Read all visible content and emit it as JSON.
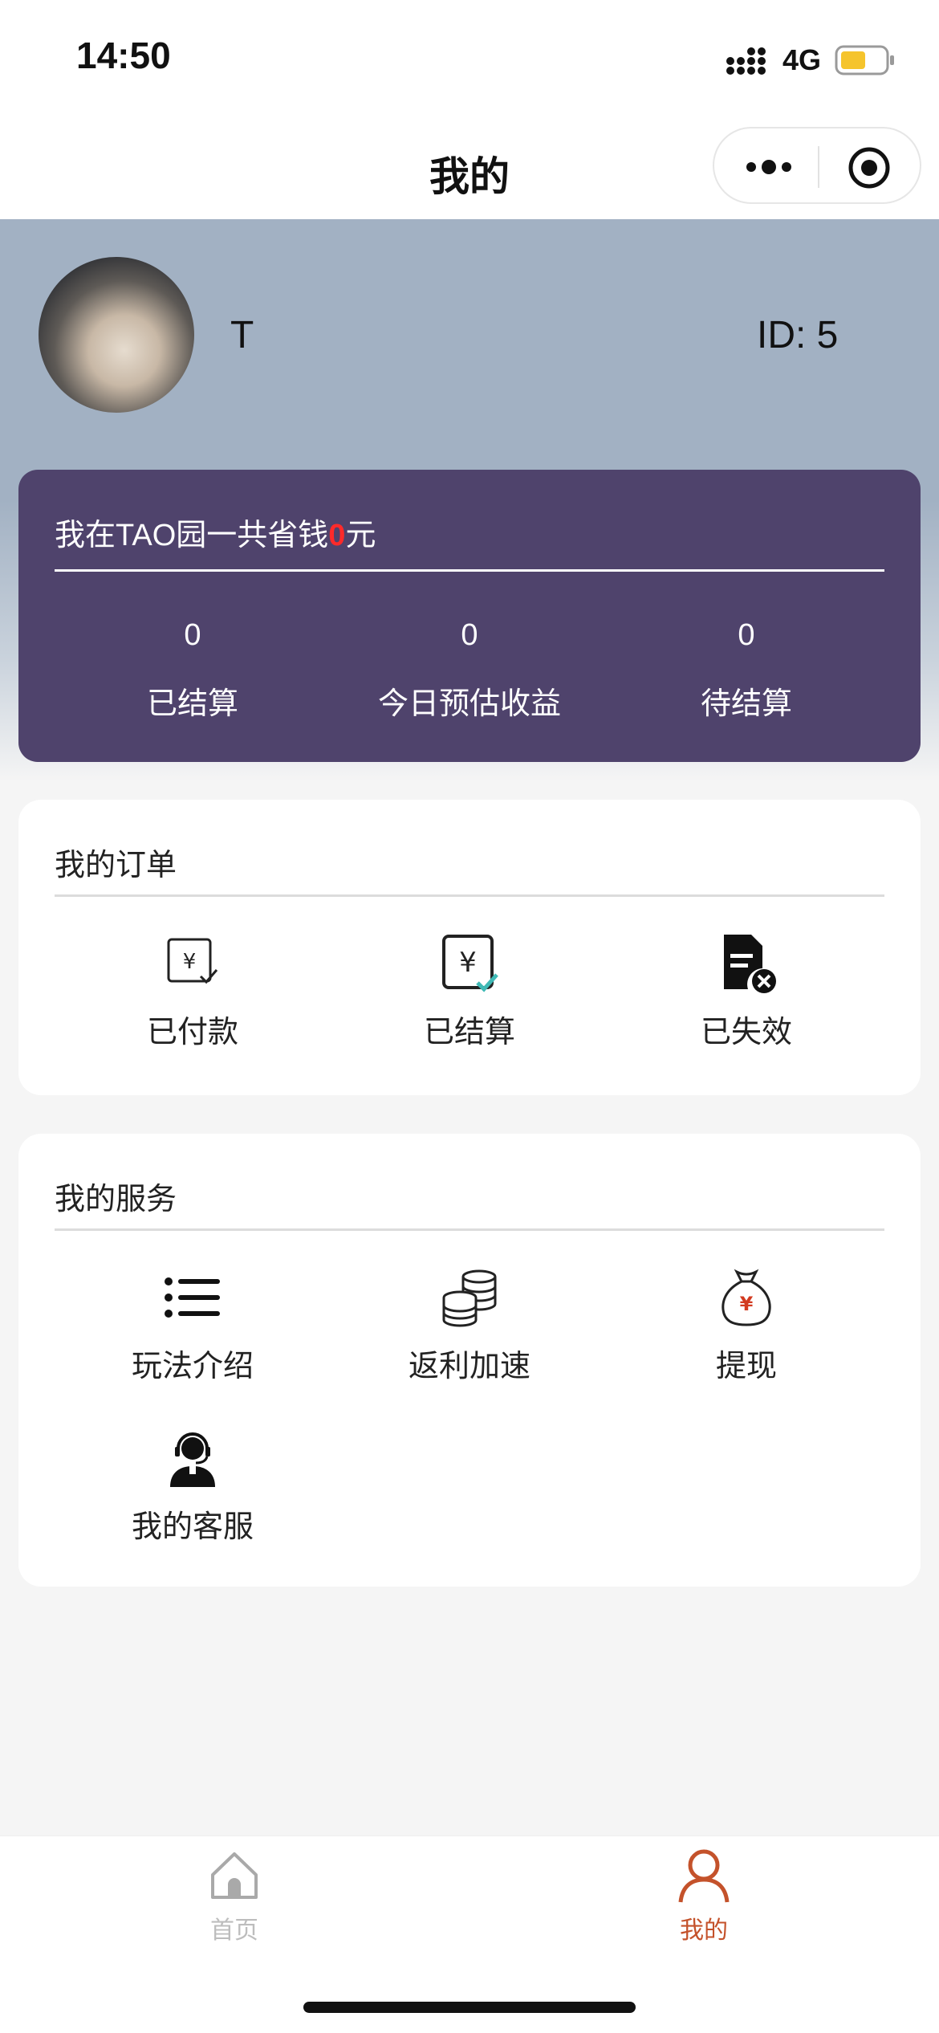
{
  "status_bar": {
    "time": "14:50",
    "network": "4G",
    "icons": [
      "signal-icon",
      "battery-icon"
    ],
    "battery_color": "#f5c42c"
  },
  "nav": {
    "title": "我的",
    "icons": [
      "more-icon",
      "close-mini-icon"
    ]
  },
  "profile": {
    "name": "T",
    "id_text": "ID: 5"
  },
  "earnings": {
    "savings_prefix": "我在TAO园一共省钱",
    "savings_amount": "0",
    "savings_suffix": "元",
    "stats": [
      {
        "value": "0",
        "label": "已结算"
      },
      {
        "value": "0",
        "label": "今日预估收益"
      },
      {
        "value": "0",
        "label": "待结算"
      }
    ],
    "card_color": "#4f436c",
    "amount_color": "#ff2a2a"
  },
  "orders": {
    "title": "我的订单",
    "items": [
      {
        "label": "已付款",
        "icon": "yuan-paid-icon"
      },
      {
        "label": "已结算",
        "icon": "yuan-settled-icon"
      },
      {
        "label": "已失效",
        "icon": "document-invalid-icon"
      }
    ]
  },
  "services": {
    "title": "我的服务",
    "items": [
      {
        "label": "玩法介绍",
        "icon": "list-icon"
      },
      {
        "label": "返利加速",
        "icon": "coins-stack-icon"
      },
      {
        "label": "提现",
        "icon": "money-bag-icon"
      },
      {
        "label": "我的客服",
        "icon": "customer-service-icon"
      }
    ]
  },
  "tab_bar": {
    "tabs": [
      {
        "label": "首页",
        "icon": "home-icon",
        "active": false
      },
      {
        "label": "我的",
        "icon": "person-icon",
        "active": true
      }
    ],
    "active_color": "#c4522b",
    "inactive_color": "#bdbdbd"
  }
}
